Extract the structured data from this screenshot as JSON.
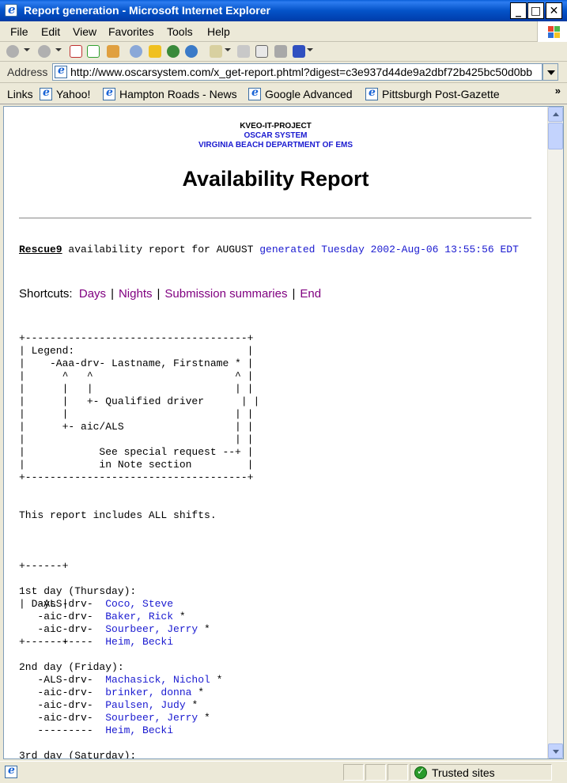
{
  "window": {
    "title": "Report generation - Microsoft Internet Explorer"
  },
  "menu": [
    "File",
    "Edit",
    "View",
    "Favorites",
    "Tools",
    "Help"
  ],
  "address": {
    "label": "Address",
    "url": "http://www.oscarsystem.com/x_get-report.phtml?digest=c3e937d44de9a2dbf72b425bc50d0bb"
  },
  "links": {
    "label": "Links",
    "items": [
      "Yahoo!",
      "Hampton Roads - News",
      "Google Advanced",
      "Pittsburgh Post-Gazette"
    ],
    "more": "»"
  },
  "page": {
    "org": "KVEO-IT-PROJECT",
    "system": "OSCAR SYSTEM",
    "department": "VIRGINIA BEACH DEPARTMENT OF EMS",
    "title": "Availability Report",
    "unit": "Rescue9",
    "report_text": " availability report for AUGUST ",
    "generated": "generated Tuesday 2002-Aug-06 13:55:56 EDT",
    "shortcuts_label": "Shortcuts:",
    "shortcuts": [
      "Days",
      "Nights",
      "Submission summaries",
      "End"
    ],
    "legend": [
      "+------------------------------------+",
      "| Legend:                            |",
      "|    -Aaa-drv- Lastname, Firstname * |",
      "|      ^   ^                       ^ |",
      "|      |   |                       | |",
      "|      |   +- Qualified driver      | |",
      "|      |                           | |",
      "|      +- aic/ALS                  | |",
      "|                                  | |",
      "|            See special request --+ |",
      "|            in Note section         |",
      "+------------------------------------+"
    ],
    "includes_text": "This report includes ALL shifts.",
    "days_box": [
      "+------+",
      "| Days |",
      "+------+"
    ],
    "days": [
      {
        "heading": "1st day (Thursday):",
        "entries": [
          {
            "role": "   -ALS-drv-  ",
            "name": "Coco, Steve",
            "mark": ""
          },
          {
            "role": "   -aic-drv-  ",
            "name": "Baker, Rick",
            "mark": " *"
          },
          {
            "role": "   -aic-drv-  ",
            "name": "Sourbeer, Jerry",
            "mark": " *"
          },
          {
            "role": "   ---------  ",
            "name": "Heim, Becki",
            "mark": ""
          }
        ]
      },
      {
        "heading": "2nd day (Friday):",
        "entries": [
          {
            "role": "   -ALS-drv-  ",
            "name": "Machasick, Nichol",
            "mark": " *"
          },
          {
            "role": "   -aic-drv-  ",
            "name": "brinker, donna",
            "mark": " *"
          },
          {
            "role": "   -aic-drv-  ",
            "name": "Paulsen, Judy",
            "mark": " *"
          },
          {
            "role": "   -aic-drv-  ",
            "name": "Sourbeer, Jerry",
            "mark": " *"
          },
          {
            "role": "   ---------  ",
            "name": "Heim, Becki",
            "mark": ""
          }
        ]
      },
      {
        "heading": "3rd day (Saturday):",
        "entries": []
      }
    ]
  },
  "status": {
    "zone": "Trusted sites"
  }
}
